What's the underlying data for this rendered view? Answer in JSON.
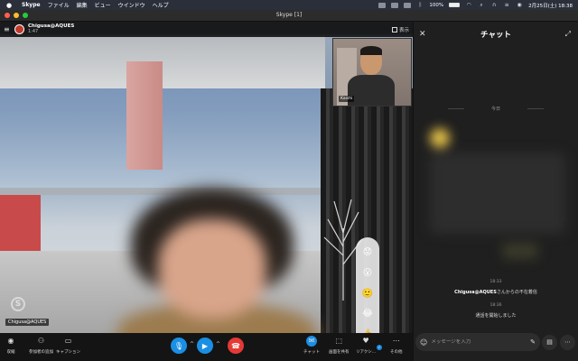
{
  "menubar": {
    "app_name": "Skype",
    "menus": [
      "ファイル",
      "編集",
      "ビュー",
      "ウインドウ",
      "ヘルプ"
    ],
    "battery_percent": "100%",
    "battery_level": 1.0,
    "datetime": "2月25日(土) 18:38"
  },
  "window": {
    "title": "Skype [1]"
  },
  "call": {
    "contact_name": "Chigusa@AQUES",
    "duration": "1:47",
    "view_label": "表示",
    "self_name": "Kaishi",
    "remote_name_tag": "Chigusa@AQUES"
  },
  "reactions": [
    "😟",
    "😮",
    "🙂",
    "😂",
    "👍",
    "❤"
  ],
  "controls": {
    "minimize": "収縮",
    "add_participant": "参加者の追加",
    "caption": "キャプション",
    "chat": "チャット",
    "share_screen": "画面を共有",
    "react": "リアクシ...",
    "more": "その他"
  },
  "colors": {
    "accent": "#1a8fe3",
    "end_call": "#e53935",
    "panel_bg": "#1f1f1f"
  },
  "chat": {
    "title": "チャット",
    "day_separator": "今日",
    "messages": [
      {
        "time": "18:33",
        "sender": "Chigusa@AQUES",
        "text": "さんからの不在着信"
      },
      {
        "time": "18:36",
        "text": "通話を開始しました"
      }
    ],
    "input_placeholder": "メッセージを入力"
  }
}
